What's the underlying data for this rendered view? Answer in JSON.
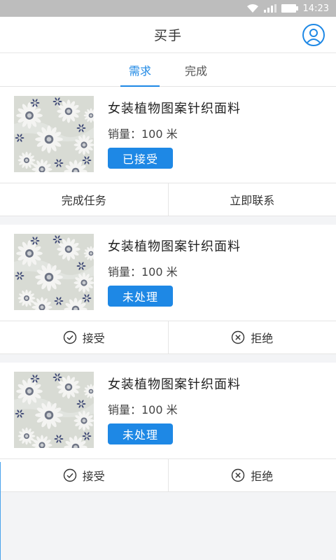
{
  "status_bar": {
    "time": "14:23"
  },
  "header": {
    "title": "买手"
  },
  "tabs": [
    {
      "label": "需求",
      "active": true
    },
    {
      "label": "完成",
      "active": false
    }
  ],
  "orders": [
    {
      "title": "女装植物图案针织面料",
      "quantity": "销量：100 米",
      "status": "已接受",
      "actions": [
        {
          "label": "完成任务",
          "icon": ""
        },
        {
          "label": "立即联系",
          "icon": ""
        }
      ]
    },
    {
      "title": "女装植物图案针织面料",
      "quantity": "销量：100 米",
      "status": "未处理",
      "actions": [
        {
          "label": "接受",
          "icon": "check-circle-icon"
        },
        {
          "label": "拒绝",
          "icon": "close-circle-icon"
        }
      ]
    },
    {
      "title": "女装植物图案针织面料",
      "quantity": "销量：100 米",
      "status": "未处理",
      "actions": [
        {
          "label": "接受",
          "icon": "check-circle-icon"
        },
        {
          "label": "拒绝",
          "icon": "close-circle-icon"
        }
      ]
    }
  ],
  "colors": {
    "accent": "#1e88e5",
    "status_bar": "#bdbdbd"
  }
}
